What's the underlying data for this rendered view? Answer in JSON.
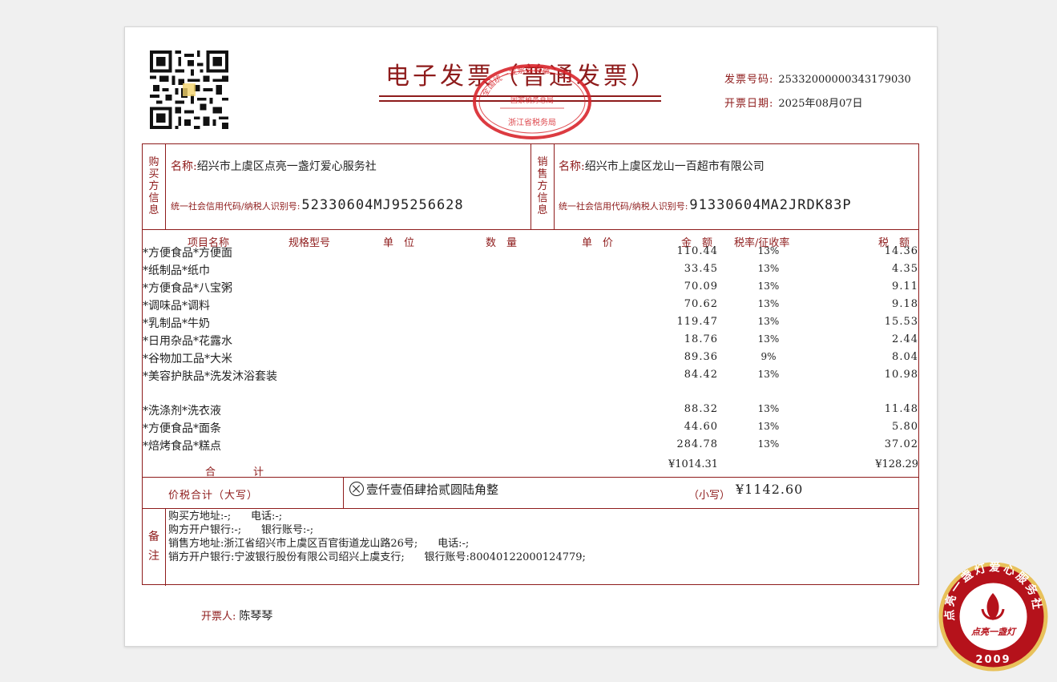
{
  "title": "电子发票（普通发票）",
  "seal_top": {
    "line1": "全国统一发票监制章",
    "line2": "国家税务总局",
    "line3": "浙江省税务局"
  },
  "invoice_no": {
    "label": "发票号码:",
    "value": "25332000000343179030"
  },
  "invoice_date": {
    "label": "开票日期:",
    "value": "2025年08月07日"
  },
  "buyer": {
    "label_chars": [
      "购",
      "买",
      "方",
      "信",
      "息"
    ],
    "name_label": "名称:",
    "name": "绍兴市上虞区点亮一盏灯爱心服务社",
    "id_label": "统一社会信用代码/纳税人识别号:",
    "id": "52330604MJ95256628"
  },
  "seller": {
    "label_chars": [
      "销",
      "售",
      "方",
      "信",
      "息"
    ],
    "name_label": "名称:",
    "name": "绍兴市上虞区龙山一百超市有限公司",
    "id_label": "统一社会信用代码/纳税人识别号:",
    "id": "91330604MA2JRDK83P"
  },
  "columns": {
    "item": "项目名称",
    "spec": "规格型号",
    "unit": "单　位",
    "qty": "数　量",
    "price": "单　价",
    "amount": "金　额",
    "rate": "税率/征收率",
    "tax": "税　额"
  },
  "items": [
    {
      "name": "*方便食品*方便面",
      "amount": "110.44",
      "rate": "13%",
      "tax": "14.36"
    },
    {
      "name": "*纸制品*纸巾",
      "amount": "33.45",
      "rate": "13%",
      "tax": "4.35"
    },
    {
      "name": "*方便食品*八宝粥",
      "amount": "70.09",
      "rate": "13%",
      "tax": "9.11"
    },
    {
      "name": "*调味品*调料",
      "amount": "70.62",
      "rate": "13%",
      "tax": "9.18"
    },
    {
      "name": "*乳制品*牛奶",
      "amount": "119.47",
      "rate": "13%",
      "tax": "15.53"
    },
    {
      "name": "*日用杂品*花露水",
      "amount": "18.76",
      "rate": "13%",
      "tax": "2.44"
    },
    {
      "name": "*谷物加工品*大米",
      "amount": "89.36",
      "rate": "9%",
      "tax": "8.04"
    },
    {
      "name": "*美容护肤品*洗发沐浴套装",
      "amount": "84.42",
      "rate": "13%",
      "tax": "10.98"
    },
    {
      "name": "*洗涤剂*洗衣液",
      "amount": "88.32",
      "rate": "13%",
      "tax": "11.48"
    },
    {
      "name": "*方便食品*面条",
      "amount": "44.60",
      "rate": "13%",
      "tax": "5.80"
    },
    {
      "name": "*焙烤食品*糕点",
      "amount": "284.78",
      "rate": "13%",
      "tax": "37.02"
    }
  ],
  "subtotal": {
    "label": "合　　　计",
    "amount": "¥1014.31",
    "tax": "¥128.29"
  },
  "total": {
    "label": "价税合计（大写）",
    "upper": "壹仟壹佰肆拾贰圆陆角整",
    "small_label": "（小写）",
    "small": "¥1142.60"
  },
  "remarks": {
    "label_chars": [
      "备",
      "注"
    ],
    "lines": [
      "购买方地址:-;      电话:-;",
      "购方开户银行:-;      银行账号:-;",
      "销售方地址:浙江省绍兴市上虞区百官街道龙山路26号;      电话:-;",
      "销方开户银行:宁波银行股份有限公司绍兴上虞支行;      银行账号:80040122000124779;"
    ]
  },
  "drawer": {
    "label": "开票人:",
    "name": "陈琴琴"
  },
  "badge": {
    "ring_text": "点亮一盏灯爱心服务社",
    "center": "点亮一盏灯",
    "year": "2009"
  },
  "colors": {
    "accent": "#8e1b1b",
    "seal": "#d8262c",
    "badge_gold": "#e8c15a"
  }
}
